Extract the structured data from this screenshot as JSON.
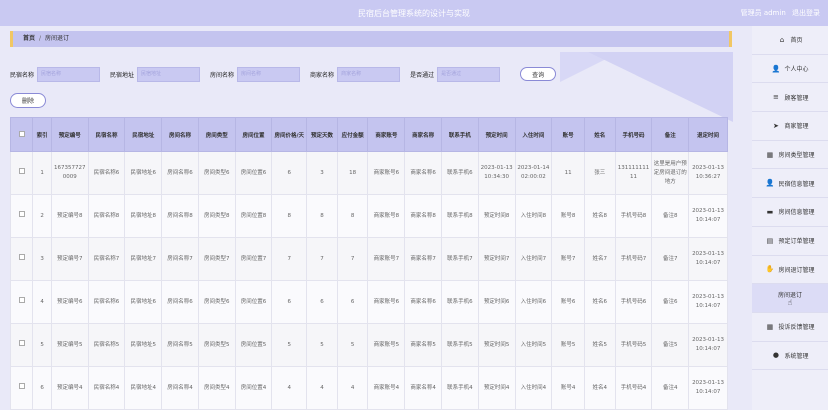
{
  "header": {
    "title": "民宿后台管理系统的设计与实现",
    "user_label": "管理员 admin",
    "logout": "退出登录"
  },
  "breadcrumb": {
    "home": "首页",
    "sep": "/",
    "current": "房间退订"
  },
  "search": {
    "fields": [
      {
        "label": "民宿名称",
        "placeholder": "民宿名称"
      },
      {
        "label": "民宿地址",
        "placeholder": "民宿地址"
      },
      {
        "label": "房间名称",
        "placeholder": "房间名称"
      },
      {
        "label": "商家名称",
        "placeholder": "商家名称"
      },
      {
        "label": "是否通过",
        "placeholder": "是否通过"
      }
    ],
    "query_label": "查询",
    "delete_label": "删除"
  },
  "table": {
    "headers": [
      "",
      "索引",
      "预定编号",
      "民宿名称",
      "民宿地址",
      "房间名称",
      "房间类型",
      "房间位置",
      "房间价格/天",
      "预定天数",
      "应付金额",
      "商家账号",
      "商家名称",
      "联系手机",
      "预定时间",
      "入住时间",
      "账号",
      "姓名",
      "手机号码",
      "备注",
      "退定时间"
    ],
    "rows": [
      [
        "",
        "1",
        "1673577270009",
        "民宿名称6",
        "民宿地址6",
        "房间名称6",
        "房间类型6",
        "房间位置6",
        "6",
        "3",
        "18",
        "商家账号6",
        "商家名称6",
        "联系手机6",
        "2023-01-13 10:34:30",
        "2023-01-14 02:00:02",
        "11",
        "张三",
        "13111111111",
        "这里是用户预定房间退订的地方",
        "2023-01-13 10:36:27"
      ],
      [
        "",
        "2",
        "预定编号8",
        "民宿名称8",
        "民宿地址8",
        "房间名称8",
        "房间类型8",
        "房间位置8",
        "8",
        "8",
        "8",
        "商家账号8",
        "商家名称8",
        "联系手机8",
        "预定时间8",
        "入住时间8",
        "账号8",
        "姓名8",
        "手机号码8",
        "备注8",
        "2023-01-13 10:14:07"
      ],
      [
        "",
        "3",
        "预定编号7",
        "民宿名称7",
        "民宿地址7",
        "房间名称7",
        "房间类型7",
        "房间位置7",
        "7",
        "7",
        "7",
        "商家账号7",
        "商家名称7",
        "联系手机7",
        "预定时间7",
        "入住时间7",
        "账号7",
        "姓名7",
        "手机号码7",
        "备注7",
        "2023-01-13 10:14:07"
      ],
      [
        "",
        "4",
        "预定编号6",
        "民宿名称6",
        "民宿地址6",
        "房间名称6",
        "房间类型6",
        "房间位置6",
        "6",
        "6",
        "6",
        "商家账号6",
        "商家名称6",
        "联系手机6",
        "预定时间6",
        "入住时间6",
        "账号6",
        "姓名6",
        "手机号码6",
        "备注6",
        "2023-01-13 10:14:07"
      ],
      [
        "",
        "5",
        "预定编号5",
        "民宿名称5",
        "民宿地址5",
        "房间名称5",
        "房间类型5",
        "房间位置5",
        "5",
        "5",
        "5",
        "商家账号5",
        "商家名称5",
        "联系手机5",
        "预定时间5",
        "入住时间5",
        "账号5",
        "姓名5",
        "手机号码5",
        "备注5",
        "2023-01-13 10:14:07"
      ],
      [
        "",
        "6",
        "预定编号4",
        "民宿名称4",
        "民宿地址4",
        "房间名称4",
        "房间类型4",
        "房间位置4",
        "4",
        "4",
        "4",
        "商家账号4",
        "商家名称4",
        "联系手机4",
        "预定时间4",
        "入住时间4",
        "账号4",
        "姓名4",
        "手机号码4",
        "备注4",
        "2023-01-13 10:14:07"
      ]
    ]
  },
  "sidebar": {
    "items": [
      {
        "label": "首页",
        "icon": "home-icon",
        "glyph": "⌂"
      },
      {
        "label": "个人中心",
        "icon": "user-icon",
        "glyph": "👤"
      },
      {
        "label": "顾客管理",
        "icon": "list-icon",
        "glyph": "≡"
      },
      {
        "label": "商家管理",
        "icon": "send-icon",
        "glyph": "➤"
      },
      {
        "label": "房间类型管理",
        "icon": "grid-icon",
        "glyph": "▦"
      },
      {
        "label": "民宿信息管理",
        "icon": "user-icon",
        "glyph": "👤"
      },
      {
        "label": "房间信息管理",
        "icon": "monitor-icon",
        "glyph": "▬"
      },
      {
        "label": "预定订单管理",
        "icon": "clipboard-icon",
        "glyph": "▤"
      },
      {
        "label": "房间退订管理",
        "icon": "hand-icon",
        "glyph": "✋"
      },
      {
        "label": "房间退订",
        "icon": "",
        "glyph": "",
        "sub": true
      },
      {
        "label": "投诉反馈管理",
        "icon": "grid-icon",
        "glyph": "▦"
      },
      {
        "label": "系统管理",
        "icon": "pin-icon",
        "glyph": "●"
      }
    ]
  },
  "colors": {
    "accent": "#c9c9f2",
    "border_accent": "#f1c764"
  }
}
